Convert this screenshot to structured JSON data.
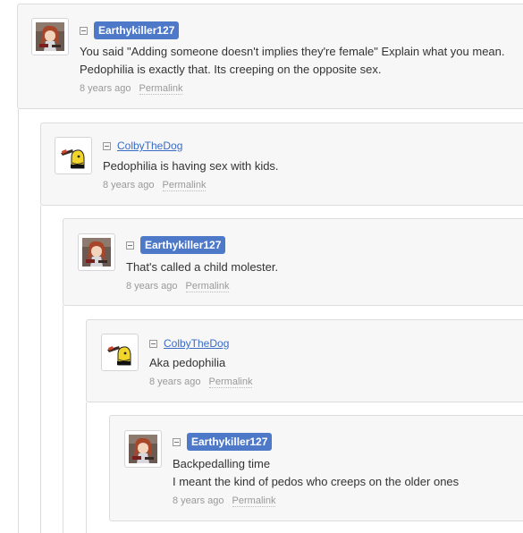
{
  "comments": [
    {
      "username": "Earthykiller127",
      "lines": [
        "You said \"Adding someone doesn't implies they're female\" Explain what you mean.",
        "Pedophilia is exactly that. Its creeping on the opposite sex."
      ],
      "time": "8 years ago",
      "permalink": "Permalink"
    },
    {
      "username": "ColbyTheDog",
      "lines": [
        "Pedophilia is having sex with kids."
      ],
      "time": "8 years ago",
      "permalink": "Permalink"
    },
    {
      "username": "Earthykiller127",
      "lines": [
        "That's called a child molester."
      ],
      "time": "8 years ago",
      "permalink": "Permalink"
    },
    {
      "username": "ColbyTheDog",
      "lines": [
        "Aka pedophilia"
      ],
      "time": "8 years ago",
      "permalink": "Permalink"
    },
    {
      "username": "Earthykiller127",
      "lines": [
        "Backpedalling time",
        "I meant the kind of pedos who creeps on the older ones"
      ],
      "time": "8 years ago",
      "permalink": "Permalink"
    }
  ],
  "colors": {
    "op_badge": "#4e78c8",
    "user_link": "#3a6bc4",
    "meta": "#999999"
  }
}
